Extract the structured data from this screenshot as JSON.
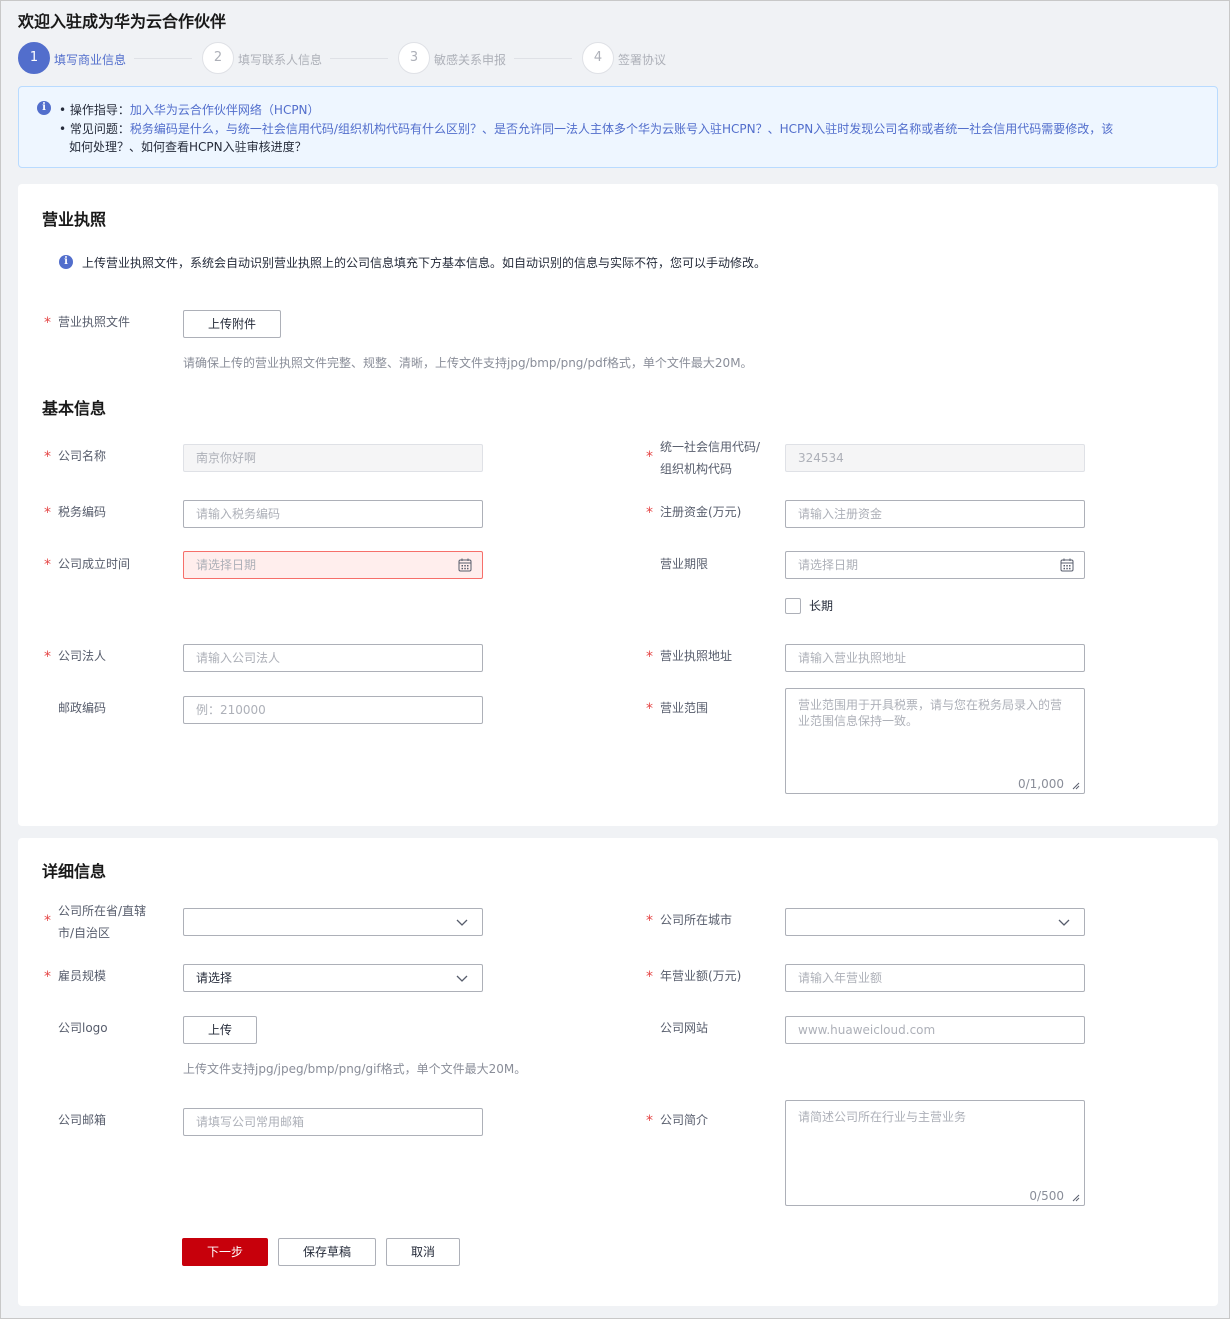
{
  "page_title": "欢迎入驻成为华为云合作伙伴",
  "steps": [
    {
      "num": "1",
      "label": "填写商业信息"
    },
    {
      "num": "2",
      "label": "填写联系人信息"
    },
    {
      "num": "3",
      "label": "敏感关系申报"
    },
    {
      "num": "4",
      "label": "签署协议"
    }
  ],
  "notice": {
    "guide_key": "操作指导：",
    "guide_link": "加入华为云合作伙伴网络（HCPN）",
    "faq_key": "常见问题：",
    "faq_text_1": "税务编码是什么，与统一社会信用代码/组织机构代码有什么区别？、是否允许同一法人主体多个华为云账号入驻HCPN？、HCPN入驻时发现公司名称或者统一社会信用代码需要修改，该",
    "faq_text_2": "如何处理？、如何查看HCPN入驻审核进度？"
  },
  "license": {
    "title": "营业执照",
    "tip": "上传营业执照文件，系统会自动识别营业执照上的公司信息填充下方基本信息。如自动识别的信息与实际不符，您可以手动修改。",
    "file_label": "营业执照文件",
    "upload_button": "上传附件",
    "upload_hint": "请确保上传的营业执照文件完整、规整、清晰，上传文件支持jpg/bmp/png/pdf格式，单个文件最大20M。"
  },
  "basic": {
    "title": "基本信息",
    "company_name_label": "公司名称",
    "company_name_value": "南京你好啊",
    "credit_code_label_1": "统一社会信用代码/",
    "credit_code_label_2": "组织机构代码",
    "credit_code_value": "324534",
    "tax_label": "税务编码",
    "tax_placeholder": "请输入税务编码",
    "capital_label": "注册资金(万元)",
    "capital_placeholder": "请输入注册资金",
    "found_label": "公司成立时间",
    "found_placeholder": "请选择日期",
    "term_label": "营业期限",
    "term_placeholder": "请选择日期",
    "long_term_label": "长期",
    "legal_label": "公司法人",
    "legal_placeholder": "请输入公司法人",
    "address_label": "营业执照地址",
    "address_placeholder": "请输入营业执照地址",
    "postcode_label": "邮政编码",
    "postcode_placeholder": "例：210000",
    "scope_label": "营业范围",
    "scope_placeholder": "营业范围用于开具税票，请与您在税务局录入的营业范围信息保持一致。",
    "scope_count": "0/1,000"
  },
  "detail": {
    "title": "详细信息",
    "province_label_1": "公司所在省/直辖",
    "province_label_2": "市/自治区",
    "city_label": "公司所在城市",
    "staff_label": "雇员规模",
    "staff_value": "请选择",
    "revenue_label": "年营业额(万元)",
    "revenue_placeholder": "请输入年营业额",
    "logo_label": "公司logo",
    "logo_button": "上传",
    "logo_hint": "上传文件支持jpg/jpeg/bmp/png/gif格式，单个文件最大20M。",
    "website_label": "公司网站",
    "website_placeholder": "www.huaweicloud.com",
    "email_label": "公司邮箱",
    "email_placeholder": "请填写公司常用邮箱",
    "intro_label": "公司简介",
    "intro_placeholder": "请简述公司所在行业与主营业务",
    "intro_count": "0/500"
  },
  "actions": {
    "next": "下一步",
    "save_draft": "保存草稿",
    "cancel": "取消"
  },
  "colors": {
    "primary": "#526ecc",
    "brand_red": "#c7000b",
    "required": "#e54545",
    "notice_bg": "#eef6ff"
  }
}
